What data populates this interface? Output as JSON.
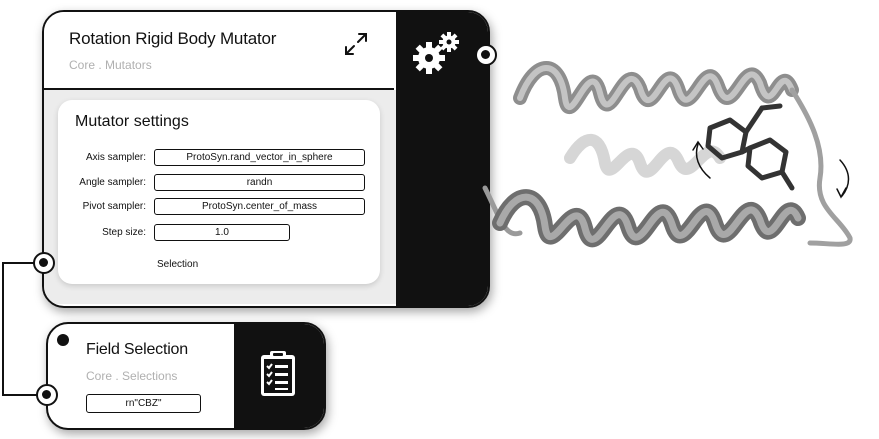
{
  "mutator": {
    "title": "Rotation Rigid Body Mutator",
    "subtitle": "Core . Mutators",
    "settings_title": "Mutator settings",
    "rows": [
      {
        "label": "Axis sampler:",
        "value": "ProtoSyn.rand_vector_in_sphere"
      },
      {
        "label": "Angle sampler:",
        "value": "randn"
      },
      {
        "label": "Pivot sampler:",
        "value": "ProtoSyn.center_of_mass"
      },
      {
        "label": "Step size:",
        "value": "1.0"
      }
    ],
    "selection_label": "Selection",
    "icons": [
      "expand-icon",
      "gears-icon"
    ]
  },
  "field_selection": {
    "title": "Field Selection",
    "subtitle": "Core . Selections",
    "value": "rn\"CBZ\"",
    "icons": [
      "clipboard-checklist-icon"
    ]
  },
  "illustration": "protein-ribbon-with-ligand"
}
